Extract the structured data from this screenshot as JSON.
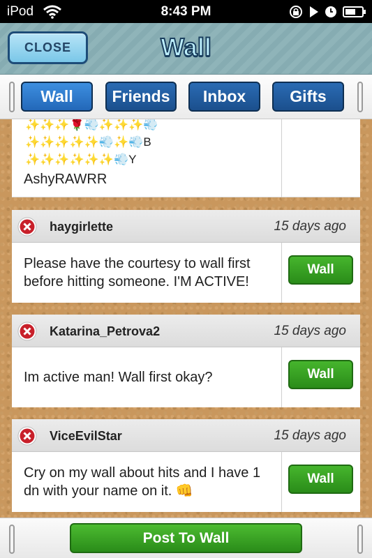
{
  "status_bar": {
    "carrier": "iPod",
    "time": "8:43 PM"
  },
  "header": {
    "close_label": "CLOSE",
    "title": "Wall"
  },
  "tabs": [
    {
      "label": "Wall",
      "active": true
    },
    {
      "label": "Friends",
      "active": false
    },
    {
      "label": "Inbox",
      "active": false
    },
    {
      "label": "Gifts",
      "active": false
    }
  ],
  "first_post": {
    "line1": "✨✨✨🌹💨✨✨✨💨",
    "line2_sparkles": "✨✨✨✨✨💨✨💨",
    "line2_letter": "B",
    "line3_sparkles": "✨✨✨✨✨✨💨",
    "line3_letter": "Y",
    "name": "AshyRAWRR"
  },
  "posts": [
    {
      "user": "haygirlette",
      "time": "15 days ago",
      "message": "Please have the courtesy to wall first before hitting someone. I'M ACTIVE!",
      "button_label": "Wall"
    },
    {
      "user": "Katarina_Petrova2",
      "time": "15 days ago",
      "message": "Im active man! Wall first okay?",
      "button_label": "Wall"
    },
    {
      "user": "ViceEvilStar",
      "time": "15 days ago",
      "message": "Cry on my wall about hits and I have 1 dn with your name on it. 👊",
      "button_label": "Wall"
    }
  ],
  "bottom": {
    "post_label": "Post To Wall"
  },
  "colors": {
    "tab_blue": "#1b4f8d",
    "button_green": "#2a8c19",
    "header_teal": "#8fb4b9",
    "cork": "#c9975d"
  }
}
